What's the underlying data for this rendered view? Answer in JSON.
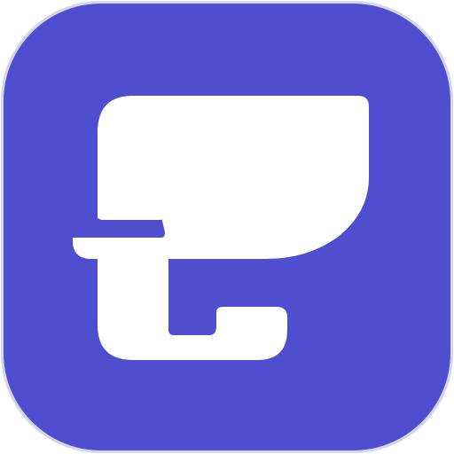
{
  "icon": {
    "name": "app-icon",
    "glyph_name": "stylized-e-logo-icon",
    "colors": {
      "page_background": "#ffffff",
      "tile_background": "#4e4ecf",
      "tile_border": "#d6d6e6",
      "glyph": "#ffffff"
    }
  }
}
